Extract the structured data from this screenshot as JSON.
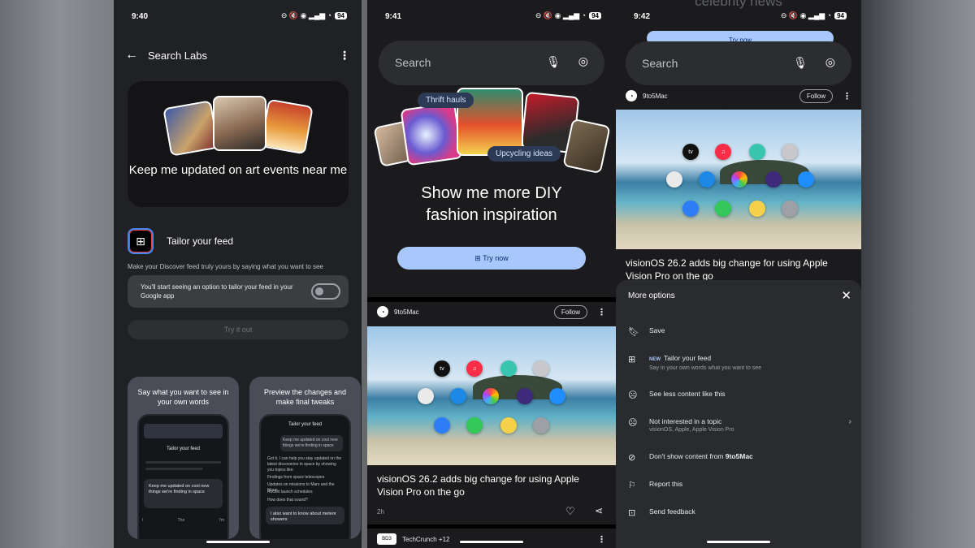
{
  "status": {
    "time1": "9:40",
    "time2": "9:41",
    "time3": "9:42",
    "battery": "94",
    "icons": "⊖ 🔇 ◉ ▂▄▆ ◔"
  },
  "screen1": {
    "title": "Search Labs",
    "hero_text": "Keep me updated on art events near me",
    "tailor_title": "Tailor your feed",
    "tailor_desc": "Make your Discover feed truly yours by saying what you want to see",
    "toggle_text": "You'll start seeing an option to tailor your feed in your Google app",
    "try_out": "Try it out",
    "promo_left": {
      "title": "Say what you want to see in your own words",
      "phone_title": "Tailor your feed",
      "input_text": "Keep me updated on cool new things we're finding in space",
      "keys": [
        "I",
        "The",
        "I'm"
      ]
    },
    "promo_right": {
      "title": "Preview the changes and make final tweaks",
      "phone_title": "Tailor your feed",
      "bubble": "Keep me updated on cool new things we're finding in space",
      "reply": "Got it. I can help you stay updated on the latest discoveries in space by showing you topics like:",
      "bullets": [
        "Findings from space telescopes",
        "Updates on missions to Mars and the Moon",
        "Rocket launch schedules"
      ],
      "question": "How does that sound?",
      "input_text": "I also want to know about meteor showers"
    }
  },
  "screen2": {
    "search_placeholder": "Search",
    "chip1": "Thrift hauls",
    "chip2": "Upcycling ideas",
    "headline": "Show me more DIY fashion inspiration",
    "try_now": "Try now",
    "source": "9to5Mac",
    "follow": "Follow",
    "article_title": "visionOS 26.2 adds big change for using Apple Vision Pro on the go",
    "age": "2h",
    "next_source": "TechCrunch +12",
    "next_source_logo": "BD3"
  },
  "screen3": {
    "top_text": "celebrity news",
    "top_button": "Try now",
    "search_placeholder": "Search",
    "source": "9to5Mac",
    "follow": "Follow",
    "article_title": "visionOS 26.2 adds big change for using Apple Vision Pro on the go",
    "sheet_title": "More options",
    "options": [
      {
        "icon": "bookmark-icon",
        "label": "Save"
      },
      {
        "icon": "tailor-icon",
        "badge": "NEW",
        "label": "Tailor your feed",
        "sub": "Say in your own words what you want to see"
      },
      {
        "icon": "sad-face-icon",
        "label": "See less content like this"
      },
      {
        "icon": "dizzy-face-icon",
        "label": "Not interested in a topic",
        "sub": "visionOS, Apple, Apple Vision Pro"
      },
      {
        "icon": "block-icon",
        "label": "Don't show content from",
        "bold": "9to5Mac"
      },
      {
        "icon": "flag-icon",
        "label": "Report this"
      },
      {
        "icon": "feedback-icon",
        "label": "Send feedback"
      }
    ]
  },
  "app_icons": [
    "tv",
    "♫",
    "",
    "",
    "",
    "",
    "",
    "",
    "",
    "",
    "",
    "",
    ""
  ],
  "colors": {
    "accent_blue": "#a8c7fa",
    "chip_bg": "#2c3a56",
    "sheet_bg": "#2a2b2e"
  }
}
